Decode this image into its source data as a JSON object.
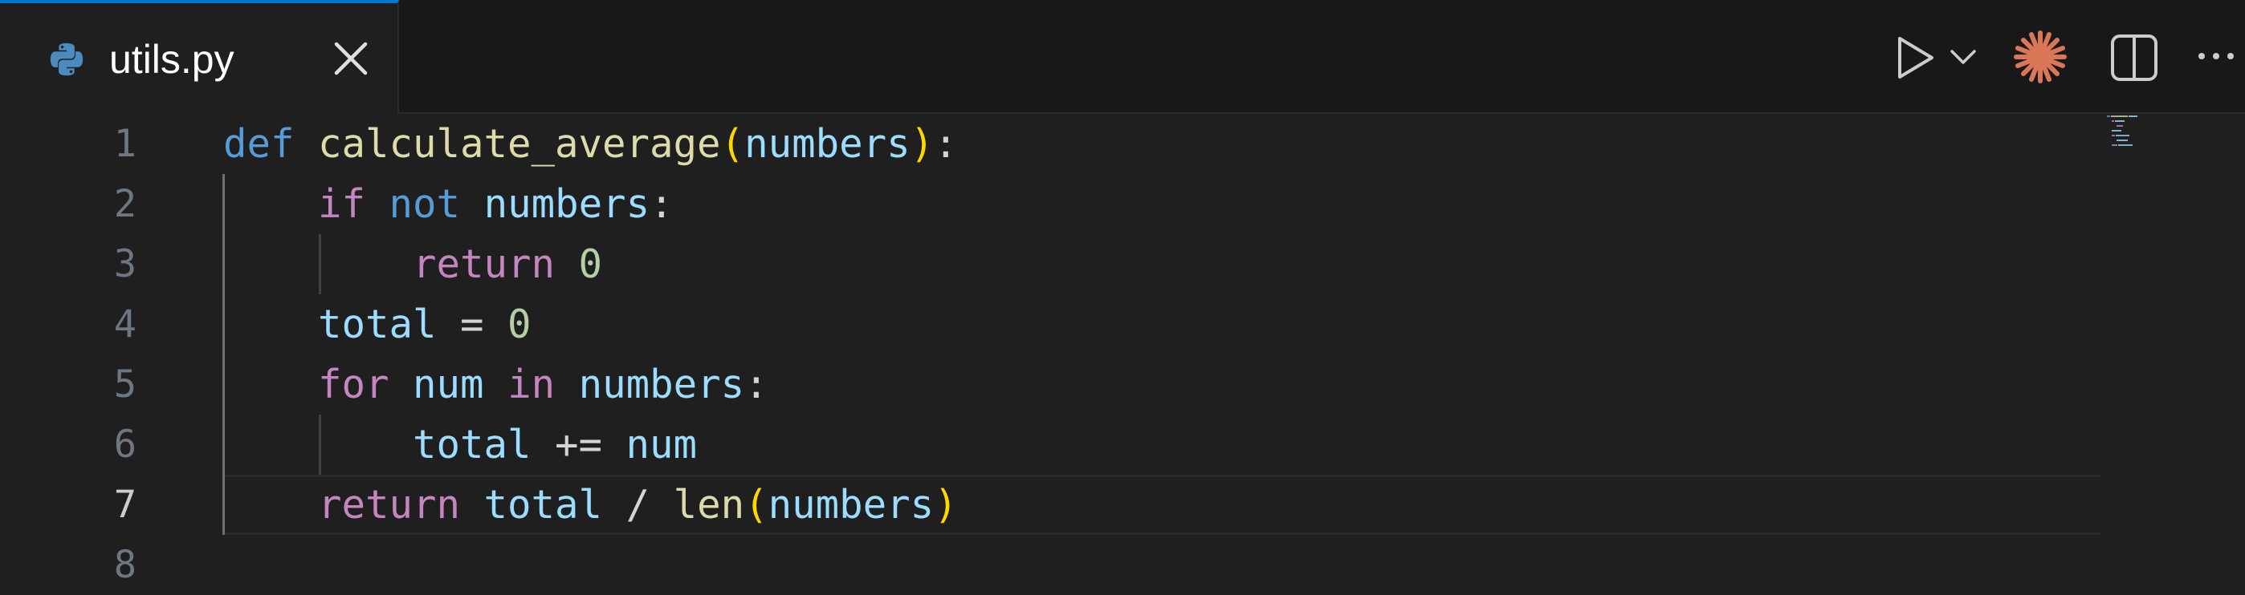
{
  "tab": {
    "filename": "utils.py",
    "icon": "python-icon",
    "close_icon": "close-icon"
  },
  "toolbar": {
    "actions": [
      "run-icon",
      "chevron-down-icon",
      "claude-sparkle-icon",
      "split-editor-icon",
      "more-icon"
    ],
    "accent_color": "#d97757"
  },
  "editor": {
    "active_line": 7,
    "lines": [
      {
        "number": "1",
        "tokens": [
          [
            "def",
            "kw-blue"
          ],
          [
            " ",
            "punc"
          ],
          [
            "calculate_average",
            "fn"
          ],
          [
            "(",
            "br"
          ],
          [
            "numbers",
            "var"
          ],
          [
            ")",
            "br"
          ],
          [
            ":",
            "punc"
          ]
        ]
      },
      {
        "number": "2",
        "tokens": [
          [
            "    ",
            "punc"
          ],
          [
            "if",
            "kw-purple"
          ],
          [
            " ",
            "punc"
          ],
          [
            "not",
            "kw-blue"
          ],
          [
            " ",
            "punc"
          ],
          [
            "numbers",
            "var"
          ],
          [
            ":",
            "punc"
          ]
        ]
      },
      {
        "number": "3",
        "tokens": [
          [
            "        ",
            "punc"
          ],
          [
            "return",
            "kw-purple"
          ],
          [
            " ",
            "punc"
          ],
          [
            "0",
            "num"
          ]
        ]
      },
      {
        "number": "4",
        "tokens": [
          [
            "    ",
            "punc"
          ],
          [
            "total",
            "var"
          ],
          [
            " = ",
            "punc"
          ],
          [
            "0",
            "num"
          ]
        ]
      },
      {
        "number": "5",
        "tokens": [
          [
            "    ",
            "punc"
          ],
          [
            "for",
            "kw-purple"
          ],
          [
            " ",
            "punc"
          ],
          [
            "num",
            "var"
          ],
          [
            " ",
            "punc"
          ],
          [
            "in",
            "kw-purple"
          ],
          [
            " ",
            "punc"
          ],
          [
            "numbers",
            "var"
          ],
          [
            ":",
            "punc"
          ]
        ]
      },
      {
        "number": "6",
        "tokens": [
          [
            "        ",
            "punc"
          ],
          [
            "total",
            "var"
          ],
          [
            " += ",
            "punc"
          ],
          [
            "num",
            "var"
          ]
        ]
      },
      {
        "number": "7",
        "tokens": [
          [
            "    ",
            "punc"
          ],
          [
            "return",
            "kw-purple"
          ],
          [
            " ",
            "punc"
          ],
          [
            "total",
            "var"
          ],
          [
            " / ",
            "punc"
          ],
          [
            "len",
            "fn"
          ],
          [
            "(",
            "br"
          ],
          [
            "numbers",
            "var"
          ],
          [
            ")",
            "br"
          ]
        ]
      },
      {
        "number": "8",
        "tokens": []
      }
    ]
  }
}
